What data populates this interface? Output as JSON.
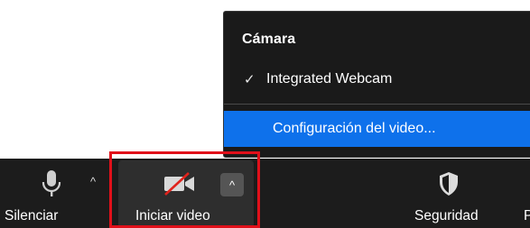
{
  "menu": {
    "header": "Cámara",
    "items": [
      {
        "check": "✓",
        "label": "Integrated Webcam",
        "selected": true
      },
      {
        "label": "Configuración del video...",
        "highlighted": true
      }
    ],
    "highlight_color": "#0e71eb"
  },
  "toolbar": {
    "mute": {
      "label": "Silenciar",
      "icon": "microphone-icon",
      "caret": "^"
    },
    "video": {
      "label": "Iniciar video",
      "icon": "video-off-icon",
      "caret": "^"
    },
    "security": {
      "label": "Seguridad",
      "icon": "shield-icon"
    },
    "participants": {
      "label": "P"
    }
  },
  "annotation": {
    "color": "#e0101a"
  }
}
